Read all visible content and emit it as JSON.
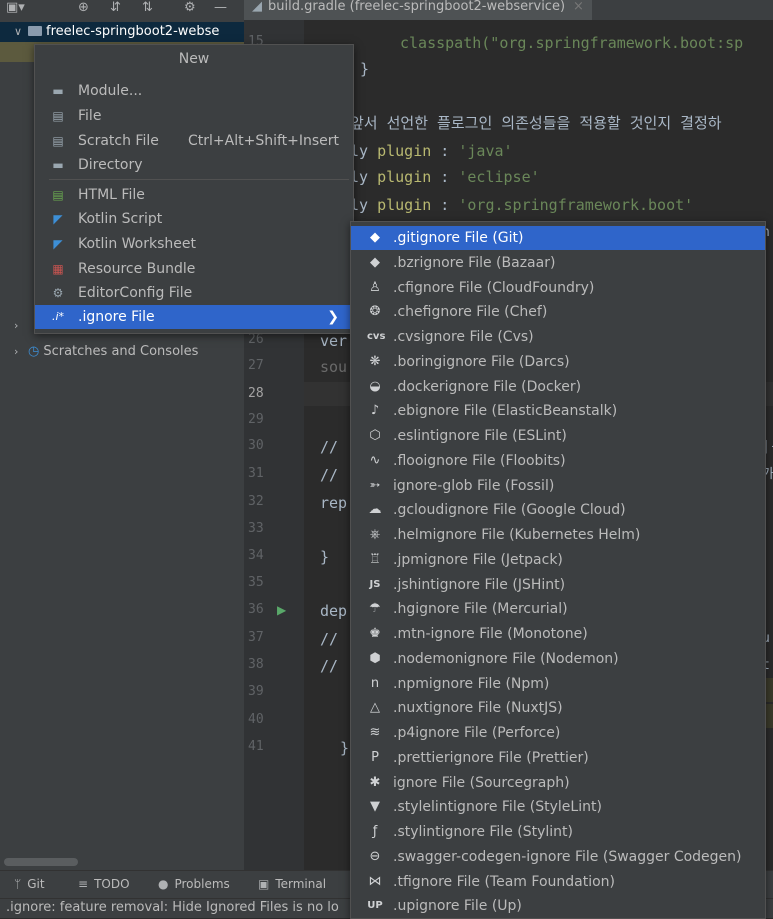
{
  "toolbar": {
    "icons": [
      "project-view-icon",
      "locate-icon",
      "expand-all-icon",
      "collapse-all-icon",
      "settings-icon",
      "hide-icon"
    ],
    "tab_title": "build.gradle (freelec-springboot2-webservice)",
    "tab_close": "×"
  },
  "project": {
    "root_label": "freelec-springboot2-webse",
    "scratches_label": "Scratches and Consoles"
  },
  "gutter": {
    "lines": [
      "15",
      "26",
      "27",
      "28",
      "29",
      "30",
      "31",
      "32",
      "33",
      "34",
      "35",
      "36",
      "37",
      "38",
      "39",
      "40",
      "41"
    ]
  },
  "editor": {
    "line_classpath": "classpath(\"org.springframework.boot:sp",
    "line_brace": "}",
    "line_comment_kr": "앞서 선언한 플로그인 의존성들을 적용할 것인지 결정하",
    "line_apply_java_pre": "ly ",
    "plugin_kw": "plugin",
    "line_apply_java_str": "'java'",
    "line_apply_eclipse_str": "'eclipse'",
    "line_apply_boot_str": "'org.springframework.boot'",
    "line_ver": "ver",
    "line_sou": "sou",
    "line_30": "//",
    "line_31": "//",
    "line_32": "rep",
    "line_34": "}",
    "line_36": "dep",
    "line_37": "//",
    "line_38": "//",
    "line_41": "}",
    "right_fragments": [
      "n",
      "|-",
      "가",
      "u",
      "t",
      "t",
      "."
    ]
  },
  "new_menu": {
    "title": "New",
    "items": [
      {
        "label": "Module...",
        "icon": "module-icon"
      },
      {
        "label": "File",
        "icon": "file-icon"
      },
      {
        "label": "Scratch File",
        "shortcut": "Ctrl+Alt+Shift+Insert",
        "icon": "scratch-file-icon"
      },
      {
        "label": "Directory",
        "icon": "directory-icon"
      },
      {
        "label": "HTML File",
        "icon": "html-file-icon"
      },
      {
        "label": "Kotlin Script",
        "icon": "kotlin-script-icon"
      },
      {
        "label": "Kotlin Worksheet",
        "icon": "kotlin-worksheet-icon"
      },
      {
        "label": "Resource Bundle",
        "icon": "resource-bundle-icon"
      },
      {
        "label": "EditorConfig File",
        "icon": "editorconfig-icon"
      },
      {
        "label": ".ignore File",
        "prefix": ".i*",
        "submenu_arrow": "❯",
        "icon": "ignore-file-icon",
        "selected": true
      }
    ]
  },
  "ignore_menu": {
    "items": [
      {
        "label": ".gitignore File (Git)",
        "icon": "git-icon",
        "glyph": "◆",
        "selected": true
      },
      {
        "label": ".bzrignore File (Bazaar)",
        "icon": "bazaar-icon",
        "glyph": "◆"
      },
      {
        "label": ".cfignore File (CloudFoundry)",
        "icon": "cloudfoundry-icon",
        "glyph": "♙"
      },
      {
        "label": ".chefignore File (Chef)",
        "icon": "chef-icon",
        "glyph": "❂"
      },
      {
        "label": ".cvsignore File (Cvs)",
        "icon": "cvs-icon",
        "glyph": "cvs"
      },
      {
        "label": ".boringignore File (Darcs)",
        "icon": "darcs-icon",
        "glyph": "❋"
      },
      {
        "label": ".dockerignore File (Docker)",
        "icon": "docker-icon",
        "glyph": "◒"
      },
      {
        "label": ".ebignore File (ElasticBeanstalk)",
        "icon": "elasticbeanstalk-icon",
        "glyph": "♪"
      },
      {
        "label": ".eslintignore File (ESLint)",
        "icon": "eslint-icon",
        "glyph": "⬡"
      },
      {
        "label": ".flooignore File (Floobits)",
        "icon": "floobits-icon",
        "glyph": "∿"
      },
      {
        "label": "ignore-glob File (Fossil)",
        "icon": "fossil-icon",
        "glyph": "➳"
      },
      {
        "label": ".gcloudignore File (Google Cloud)",
        "icon": "google-cloud-icon",
        "glyph": "☁"
      },
      {
        "label": ".helmignore File (Kubernetes Helm)",
        "icon": "helm-icon",
        "glyph": "⎈"
      },
      {
        "label": ".jpmignore File (Jetpack)",
        "icon": "jetpack-icon",
        "glyph": "♖"
      },
      {
        "label": ".jshintignore File (JSHint)",
        "icon": "jshint-icon",
        "glyph": "JS"
      },
      {
        "label": ".hgignore File (Mercurial)",
        "icon": "mercurial-icon",
        "glyph": "☂"
      },
      {
        "label": ".mtn-ignore File (Monotone)",
        "icon": "monotone-icon",
        "glyph": "♚"
      },
      {
        "label": ".nodemonignore File (Nodemon)",
        "icon": "nodemon-icon",
        "glyph": "⬢"
      },
      {
        "label": ".npmignore File (Npm)",
        "icon": "npm-icon",
        "glyph": "n"
      },
      {
        "label": ".nuxtignore File (NuxtJS)",
        "icon": "nuxtjs-icon",
        "glyph": "△"
      },
      {
        "label": ".p4ignore File (Perforce)",
        "icon": "perforce-icon",
        "glyph": "≋"
      },
      {
        "label": ".prettierignore File (Prettier)",
        "icon": "prettier-icon",
        "glyph": "P"
      },
      {
        "label": "ignore File (Sourcegraph)",
        "icon": "sourcegraph-icon",
        "glyph": "✱"
      },
      {
        "label": ".stylelintignore File (StyleLint)",
        "icon": "stylelint-icon",
        "glyph": "▼"
      },
      {
        "label": ".stylintignore File (Stylint)",
        "icon": "stylint-icon",
        "glyph": "ƒ"
      },
      {
        "label": ".swagger-codegen-ignore File (Swagger Codegen)",
        "icon": "swagger-icon",
        "glyph": "⊖"
      },
      {
        "label": ".tfignore File (Team Foundation)",
        "icon": "team-foundation-icon",
        "glyph": "⋈"
      },
      {
        "label": ".upignore File (Up)",
        "icon": "up-icon",
        "glyph": "UP"
      }
    ]
  },
  "tool_windows": {
    "git": "Git",
    "todo": "TODO",
    "problems": "Problems",
    "terminal": "Terminal"
  },
  "status": {
    "message": ".ignore: feature removal: Hide Ignored Files is no lo"
  },
  "colors": {
    "selection": "#2f65ca",
    "panel": "#3c3f41",
    "editor_bg": "#2b2b2b"
  }
}
